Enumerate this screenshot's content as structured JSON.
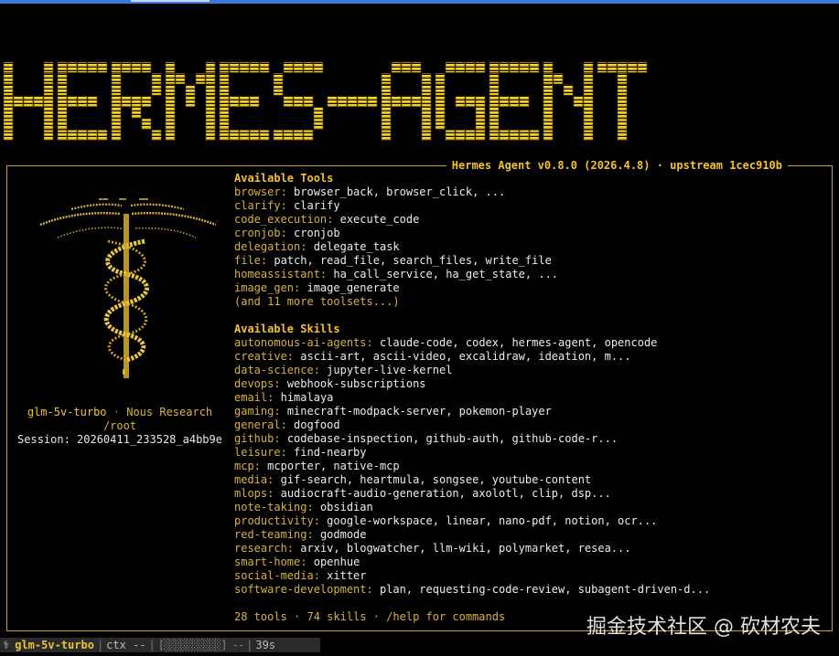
{
  "banner": {
    "text": "HERMES-AGENT"
  },
  "panel": {
    "title": "Hermes Agent v0.8.0 (2026.4.8) · upstream 1cec910b"
  },
  "left": {
    "model": "glm-5v-turbo",
    "separator": "·",
    "org": "Nous Research",
    "cwd": "/root",
    "session": "Session: 20260411_233528_a4bb9e"
  },
  "tools": {
    "heading": "Available Tools",
    "items": [
      {
        "key": "browser:",
        "value": "browser_back, browser_click, ..."
      },
      {
        "key": "clarify:",
        "value": "clarify"
      },
      {
        "key": "code_execution:",
        "value": "execute_code"
      },
      {
        "key": "cronjob:",
        "value": "cronjob"
      },
      {
        "key": "delegation:",
        "value": "delegate_task"
      },
      {
        "key": "file:",
        "value": "patch, read_file, search_files, write_file"
      },
      {
        "key": "homeassistant:",
        "value": "ha_call_service, ha_get_state, ..."
      },
      {
        "key": "image_gen:",
        "value": "image_generate"
      }
    ],
    "more": "(and 11 more toolsets...)"
  },
  "skills": {
    "heading": "Available Skills",
    "items": [
      {
        "key": "autonomous-ai-agents:",
        "value": "claude-code, codex, hermes-agent, opencode"
      },
      {
        "key": "creative:",
        "value": "ascii-art, ascii-video, excalidraw, ideation, m..."
      },
      {
        "key": "data-science:",
        "value": "jupyter-live-kernel"
      },
      {
        "key": "devops:",
        "value": "webhook-subscriptions"
      },
      {
        "key": "email:",
        "value": "himalaya"
      },
      {
        "key": "gaming:",
        "value": "minecraft-modpack-server, pokemon-player"
      },
      {
        "key": "general:",
        "value": "dogfood"
      },
      {
        "key": "github:",
        "value": "codebase-inspection, github-auth, github-code-r..."
      },
      {
        "key": "leisure:",
        "value": "find-nearby"
      },
      {
        "key": "mcp:",
        "value": "mcporter, native-mcp"
      },
      {
        "key": "media:",
        "value": "gif-search, heartmula, songsee, youtube-content"
      },
      {
        "key": "mlops:",
        "value": "audiocraft-audio-generation, axolotl, clip, dsp..."
      },
      {
        "key": "note-taking:",
        "value": "obsidian"
      },
      {
        "key": "productivity:",
        "value": "google-workspace, linear, nano-pdf, notion, ocr..."
      },
      {
        "key": "red-teaming:",
        "value": "godmode"
      },
      {
        "key": "research:",
        "value": "arxiv, blogwatcher, llm-wiki, polymarket, resea..."
      },
      {
        "key": "smart-home:",
        "value": "openhue"
      },
      {
        "key": "social-media:",
        "value": "xitter"
      },
      {
        "key": "software-development:",
        "value": "plan, requesting-code-review, subagent-driven-d..."
      }
    ]
  },
  "footer": "28 tools · 74 skills · /help for commands",
  "watermark": "掘金技术社区 @ 砍材农夫",
  "statusbar": {
    "icon": "⚕",
    "model": "glm-5v-turbo",
    "ctx": "ctx --",
    "bar": "[░░░░░░░░░░] --",
    "time": "39s"
  },
  "colors": {
    "accent": "#f2c230",
    "key": "#d9b13a",
    "border": "#c9a227",
    "background": "#000000"
  }
}
